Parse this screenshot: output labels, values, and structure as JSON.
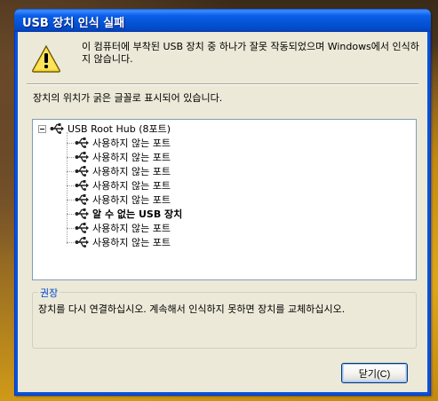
{
  "window": {
    "title": "USB 장치 인식 실패"
  },
  "message": {
    "text": "이 컴퓨터에 부착된 USB 장치 중 하나가 잘못 작동되었으며 Windows에서 인식하지 않습니다."
  },
  "instruction": {
    "text": "장치의 위치가 굵은 글꼴로 표시되어 있습니다."
  },
  "tree": {
    "root_label": "USB Root Hub (8포트)",
    "items": [
      {
        "label": "사용하지 않는 포트",
        "bold": false
      },
      {
        "label": "사용하지 않는 포트",
        "bold": false
      },
      {
        "label": "사용하지 않는 포트",
        "bold": false
      },
      {
        "label": "사용하지 않는 포트",
        "bold": false
      },
      {
        "label": "사용하지 않는 포트",
        "bold": false
      },
      {
        "label": "알 수 없는 USB 장치",
        "bold": true
      },
      {
        "label": "사용하지 않는 포트",
        "bold": false
      },
      {
        "label": "사용하지 않는 포트",
        "bold": false
      }
    ]
  },
  "recommendation": {
    "title": "권장",
    "text": "장치를 다시 연결하십시오. 계속해서 인식하지 못하면 장치를 교체하십시오."
  },
  "buttons": {
    "close_label": "닫기(C)"
  },
  "colors": {
    "titlebar": "#0454d8",
    "window_face": "#ece9d8",
    "group_title": "#0046d5"
  }
}
